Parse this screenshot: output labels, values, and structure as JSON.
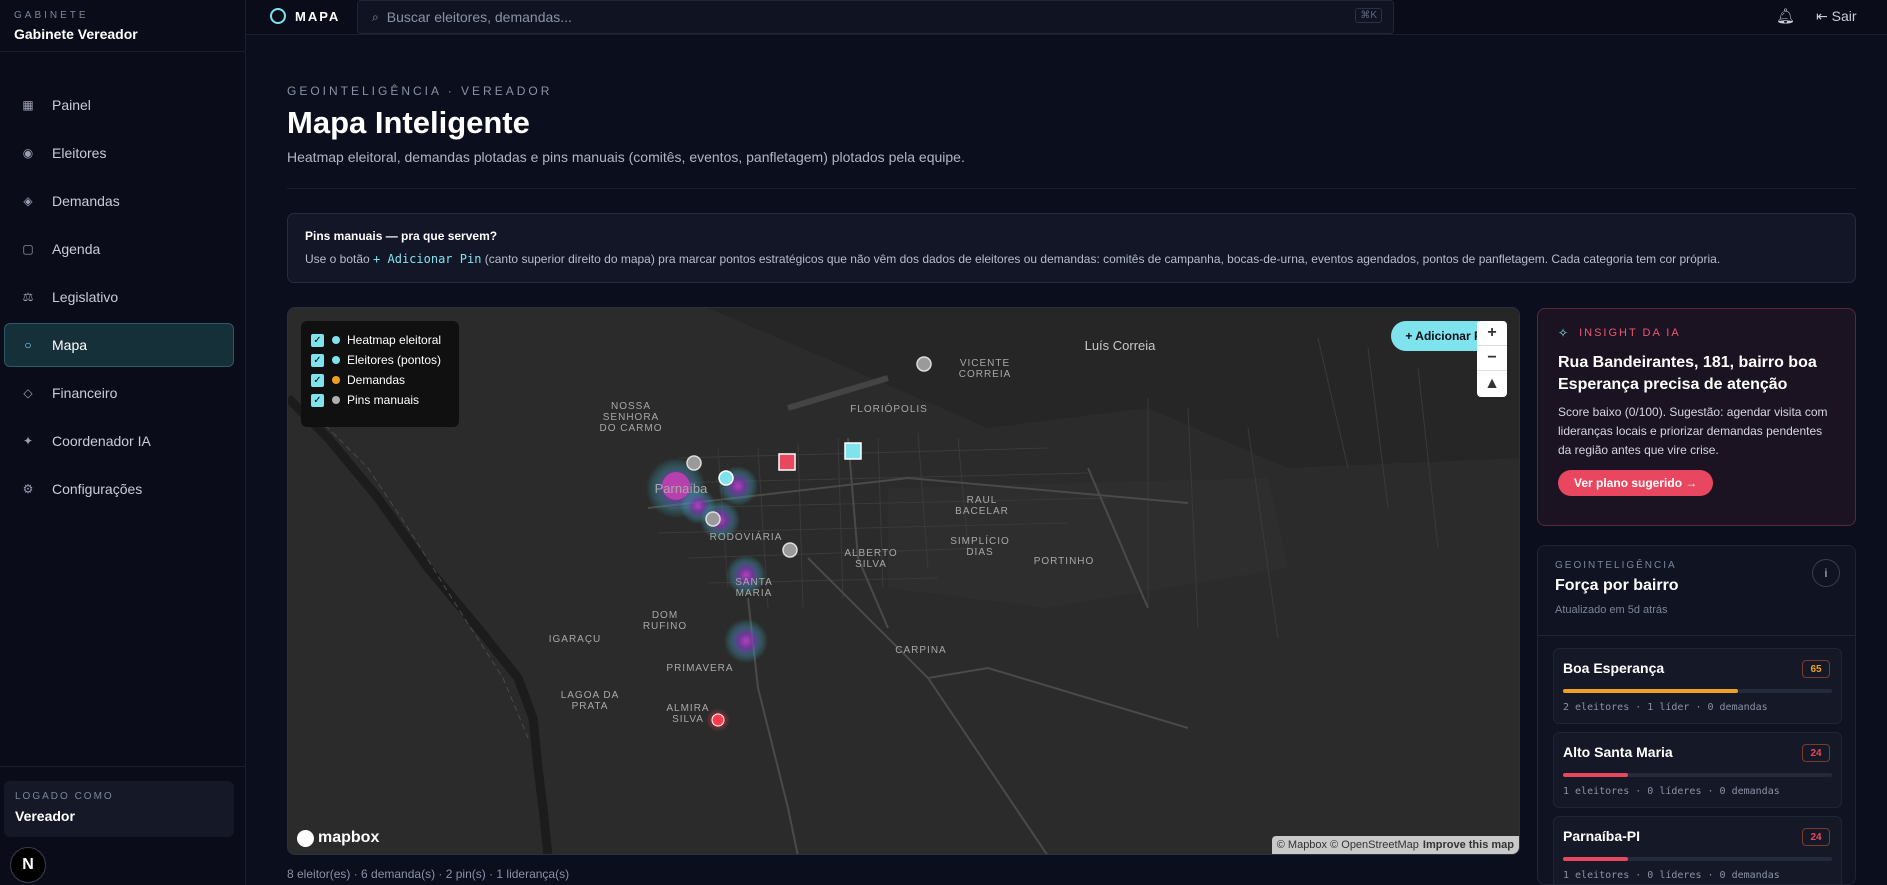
{
  "sidebar": {
    "kicker": "GABINETE",
    "title": "Gabinete Vereador",
    "items": [
      {
        "label": "Painel",
        "icon": "grid-icon"
      },
      {
        "label": "Eleitores",
        "icon": "target-icon"
      },
      {
        "label": "Demandas",
        "icon": "diamond-icon"
      },
      {
        "label": "Agenda",
        "icon": "square-icon"
      },
      {
        "label": "Legislativo",
        "icon": "scale-icon"
      },
      {
        "label": "Mapa",
        "icon": "circle-icon",
        "active": true
      },
      {
        "label": "Financeiro",
        "icon": "diamond-outline-icon"
      },
      {
        "label": "Coordenador IA",
        "icon": "sparkle-icon"
      },
      {
        "label": "Configurações",
        "icon": "gear-icon"
      }
    ],
    "logged_kicker": "LOGADO COMO",
    "logged_name": "Vereador",
    "avatar_letter": "N"
  },
  "topbar": {
    "title": "MAPA",
    "search_placeholder": "Buscar eleitores, demandas...",
    "shortcut": "⌘K",
    "logout": "Sair"
  },
  "header": {
    "kicker": "GEOINTELIGÊNCIA · VEREADOR",
    "title": "Mapa Inteligente",
    "subtitle": "Heatmap eleitoral, demandas plotadas e pins manuais (comitês, eventos, panfletagem) plotados pela equipe."
  },
  "info": {
    "title": "Pins manuais — pra que servem?",
    "before": "Use o botão ",
    "code": "+ Adicionar Pin",
    "after": " (canto superior direito do mapa) pra marcar pontos estratégicos que não vêm dos dados de eleitores ou demandas: comitês de campanha, bocas-de-urna, eventos agendados, pontos de panfletagem. Cada categoria tem cor própria."
  },
  "map": {
    "layers": [
      {
        "label": "Heatmap eleitoral",
        "color": "#7fe3ee"
      },
      {
        "label": "Eleitores (pontos)",
        "color": "#7fe3ee"
      },
      {
        "label": "Demandas",
        "color": "#f0a020"
      },
      {
        "label": "Pins manuais",
        "color": "#b0b0b0"
      }
    ],
    "add_pin": "+ Adicionar Pin",
    "zoom_in": "+",
    "zoom_out": "−",
    "compass": "▲",
    "logo": "mapbox",
    "attribution": "© Mapbox © OpenStreetMap",
    "improve": "Improve this map",
    "place_labels": [
      "Luís Correia",
      "VICENTE",
      "CORREIA",
      "FLORIÓPOLIS",
      "NOSSA",
      "SENHORA",
      "DO CARMO",
      "Parnaíba",
      "RAUL",
      "BACELAR",
      "RODOVIÁRIA",
      "ALBERTO",
      "SILVA",
      "SIMPLÍCIO",
      "DIAS",
      "PORTINHO",
      "SANTA",
      "MARIA",
      "DOM",
      "RUFINO",
      "IGARAÇU",
      "CARPINA",
      "PRIMAVERA",
      "LAGOA DA",
      "PRATA",
      "ALMIRA",
      "SILVA"
    ]
  },
  "map_stats": "8 eleitor(es) · 6 demanda(s) · 2 pin(s) · 1 liderança(s)",
  "insight": {
    "kicker": "INSIGHT DA IA",
    "title": "Rua Bandeirantes, 181, bairro boa Esperança precisa de atenção",
    "body": "Score baixo (0/100). Sugestão: agendar visita com lideranças locais e priorizar demandas pendentes da região antes que vire crise.",
    "button": "Ver plano sugerido →"
  },
  "force": {
    "kicker": "GEOINTELIGÊNCIA",
    "title": "Força por bairro",
    "updated": "Atualizado em 5d atrás",
    "info": "i",
    "rows": [
      {
        "name": "Boa Esperança",
        "score": "65",
        "score_value": 65,
        "color": "#f0a020",
        "meta": "2 eleitores · 1 líder · 0 demandas"
      },
      {
        "name": "Alto Santa Maria",
        "score": "24",
        "score_value": 24,
        "color": "#e8475f",
        "meta": "1 eleitores · 0 líderes · 0 demandas"
      },
      {
        "name": "Parnaíba-PI",
        "score": "24",
        "score_value": 24,
        "color": "#e8475f",
        "meta": "1 eleitores · 0 líderes · 0 demandas"
      }
    ]
  }
}
